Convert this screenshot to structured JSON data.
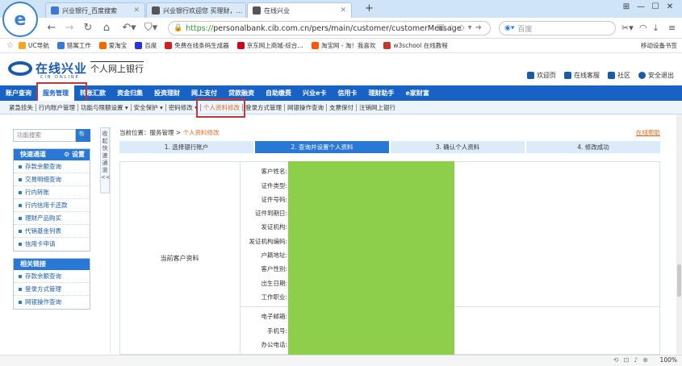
{
  "browser": {
    "tabs": [
      {
        "title": "兴业银行_百度搜索",
        "active": false
      },
      {
        "title": "兴业银行欢迎您 买理财，…",
        "active": false
      },
      {
        "title": "在线兴业",
        "active": true
      }
    ],
    "new_tab": "+",
    "window_controls": [
      "⊞",
      "—",
      "☐",
      "✕"
    ],
    "url_scheme": "https://",
    "url_rest": "personalbank.cib.com.cn/pers/main/customer/customerMessage",
    "search_engine": "百度",
    "bookmarks": [
      {
        "label": "UC导航",
        "color": "#f5a623"
      },
      {
        "label": "猎寓工作",
        "color": "#3b78d8"
      },
      {
        "label": "爱淘宝",
        "color": "#f56a00"
      },
      {
        "label": "百度",
        "color": "#2932e1"
      },
      {
        "label": "免费在线条码生成器",
        "color": "#cc2222"
      },
      {
        "label": "京东网上商城-综合…",
        "color": "#d0021b"
      },
      {
        "label": "淘宝网 - 淘！我喜欢",
        "color": "#ff5500"
      },
      {
        "label": "w3school 在线教程",
        "color": "#c0392b"
      }
    ],
    "bookmarks_right": "移动设备书签",
    "zoom": "100%"
  },
  "bank": {
    "logo_name": "在线兴业",
    "logo_sub": "CIB ONLINE",
    "title": "个人网上银行",
    "top_links": [
      "欢迎页",
      "在线客服",
      "社区",
      "安全退出"
    ],
    "main_menu": [
      {
        "label": "账户查询",
        "active": false
      },
      {
        "label": "服务管理",
        "active": true
      },
      {
        "label": "转账汇款",
        "active": false
      },
      {
        "label": "资金归集",
        "active": false
      },
      {
        "label": "投资理财",
        "active": false
      },
      {
        "label": "网上支付",
        "active": false
      },
      {
        "label": "贷款融资",
        "active": false
      },
      {
        "label": "自助缴费",
        "active": false
      },
      {
        "label": "兴业e卡",
        "active": false
      },
      {
        "label": "信用卡",
        "active": false
      },
      {
        "label": "理财助手",
        "active": false
      },
      {
        "label": "e家财富",
        "active": false
      }
    ],
    "sub_menu": [
      {
        "label": "紧急挂失",
        "active": false
      },
      {
        "label": "行内账户管理",
        "active": false
      },
      {
        "label": "功能与限额设置 ▾",
        "active": false
      },
      {
        "label": "安全保护 ▾",
        "active": false
      },
      {
        "label": "密码修改 ▾",
        "active": false
      },
      {
        "label": "个人资料修改",
        "active": true
      },
      {
        "label": "登录方式管理",
        "active": false
      },
      {
        "label": "网银操作查询",
        "active": false
      },
      {
        "label": "支票保付",
        "active": false
      },
      {
        "label": "注销网上银行",
        "active": false
      }
    ]
  },
  "sidebar": {
    "search_placeholder": "功能搜索",
    "search_icon": "🔍",
    "quick_title": "快速通道",
    "quick_settings": "⚙ 设置",
    "quick_items": [
      "存款余额查询",
      "交易明细查询",
      "行内转账",
      "行内信用卡还款",
      "理财产品购买",
      "代销基金列表",
      "信用卡申请"
    ],
    "related_title": "相关链接",
    "related_items": [
      "存款余额查询",
      "登录方式管理",
      "网银操作查询"
    ],
    "collapse_text": "收起快速通道<<"
  },
  "content": {
    "breadcrumb_prefix": "当前位置：",
    "breadcrumb_parent": "服务管理",
    "breadcrumb_sep": " > ",
    "breadcrumb_current": "个人资料修改",
    "help": "在线帮助",
    "steps": [
      {
        "label": "1. 选择银行账户",
        "active": false
      },
      {
        "label": "2. 查询并设置个人资料",
        "active": true
      },
      {
        "label": "3. 确认个人资料",
        "active": false
      },
      {
        "label": "4. 修改成功",
        "active": false
      }
    ],
    "section_label": "当前客户资料",
    "fields": [
      "客户姓名:",
      "证件类型:",
      "证件号码:",
      "证件到期日:",
      "发证机构:",
      "发证机构编码:",
      "户籍地址:",
      "客户性别:",
      "出生日期:",
      "工作职业:",
      "电子邮箱:",
      "手机号:",
      "办公电话:"
    ]
  },
  "highlight_color": "#c0373b",
  "accent_color": "#1862c6",
  "redacted_color": "#8dce4b"
}
